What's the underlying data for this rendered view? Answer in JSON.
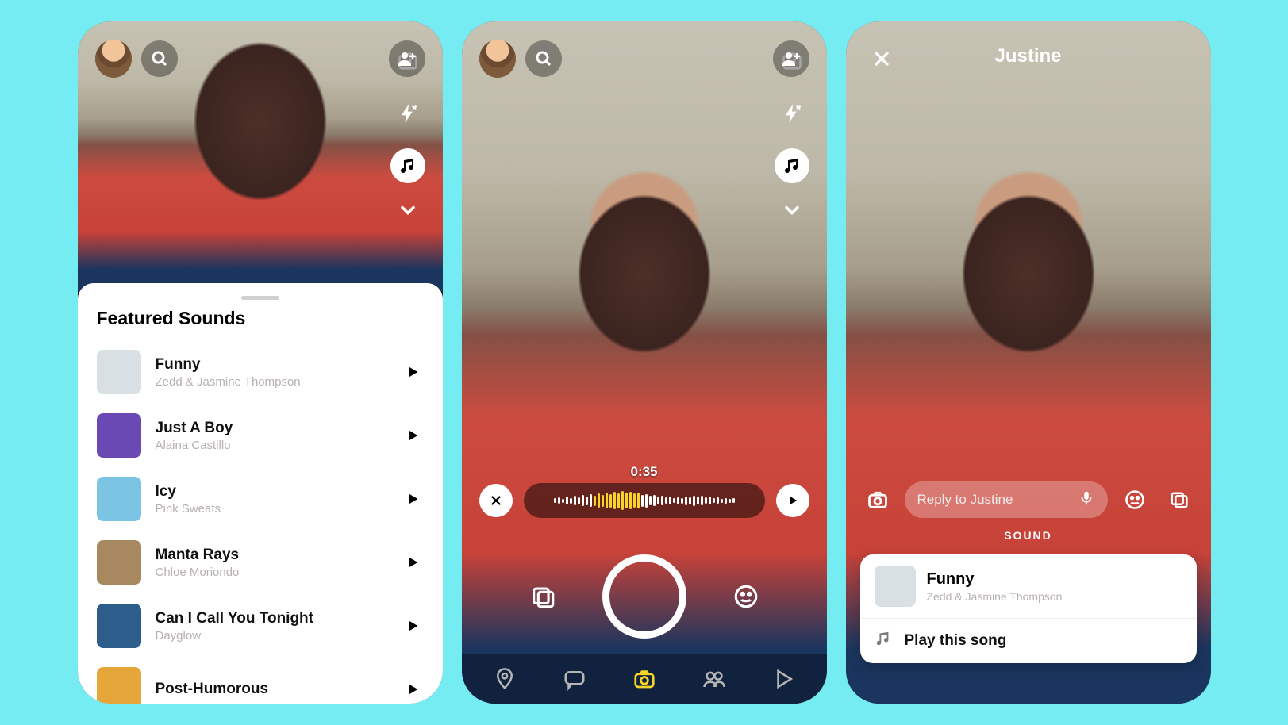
{
  "phone1": {
    "sheet_title": "Featured Sounds",
    "sounds": [
      {
        "title": "Funny",
        "artist": "Zedd & Jasmine Thompson",
        "art": "#d8e0e4"
      },
      {
        "title": "Just A Boy",
        "artist": "Alaina Castillo",
        "art": "#6b49b5"
      },
      {
        "title": "Icy",
        "artist": "Pink Sweats",
        "art": "#7cc4e4"
      },
      {
        "title": "Manta Rays",
        "artist": "Chloe Moriondo",
        "art": "#a8895f"
      },
      {
        "title": "Can I Call You Tonight",
        "artist": "Dayglow",
        "art": "#2d5d8a"
      },
      {
        "title": "Post-Humorous",
        "artist": "",
        "art": "#e5a63a"
      }
    ]
  },
  "phone2": {
    "timestamp": "0:35"
  },
  "phone3": {
    "title": "Justine",
    "reply_placeholder": "Reply to Justine",
    "sound_section_label": "SOUND",
    "now_playing": {
      "title": "Funny",
      "artist": "Zedd & Jasmine Thompson",
      "art": "#d8e0e4"
    },
    "play_this_label": "Play this song"
  },
  "icons": {
    "search": "search-icon",
    "add_friend": "add-friend-icon",
    "flip_camera": "flip-camera-icon",
    "flash": "flash-icon",
    "music": "music-icon",
    "chevron_down": "chevron-down-icon",
    "close": "close-icon",
    "play": "play-icon",
    "nav_map": "map-nav-icon",
    "nav_chat": "chat-nav-icon",
    "nav_camera": "camera-nav-icon",
    "nav_stories": "stories-nav-icon",
    "nav_spotlight": "spotlight-nav-icon",
    "memories": "memories-icon",
    "lenses": "lenses-icon",
    "camera": "camera-icon",
    "mic": "mic-icon",
    "emoji": "emoji-icon",
    "attachments": "attachments-icon",
    "music_note": "music-note-icon"
  }
}
